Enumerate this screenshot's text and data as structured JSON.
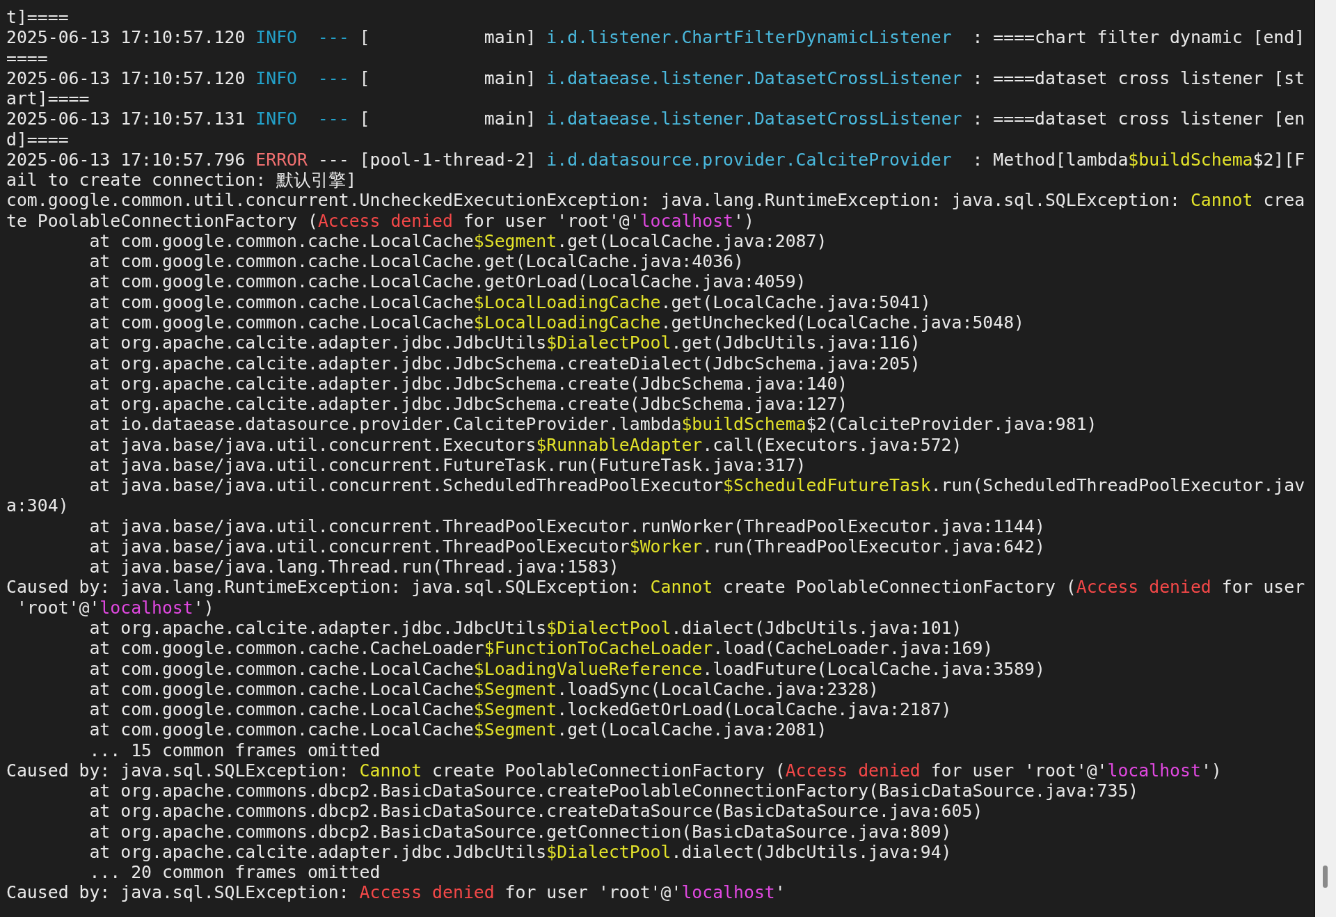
{
  "terminal": {
    "lines": [
      {
        "kind": "plain",
        "segments": [
          "t]===="
        ]
      },
      {
        "kind": "plain",
        "segments": [
          "2025-06-13 17:10:57.120 ",
          {
            "kind": "info",
            "text": "INFO  ---"
          },
          " [           main] ",
          {
            "kind": "logger",
            "text": "i.d.listener.ChartFilterDynamicListener"
          },
          "  : ====chart filter dynamic [end]"
        ]
      },
      {
        "kind": "plain",
        "segments": [
          "===="
        ]
      },
      {
        "kind": "plain",
        "segments": [
          "2025-06-13 17:10:57.120 ",
          {
            "kind": "info",
            "text": "INFO  ---"
          },
          " [           main] ",
          {
            "kind": "logger",
            "text": "i.dataease.listener.DatasetCrossListener"
          },
          " : ====dataset cross listener [st"
        ]
      },
      {
        "kind": "plain",
        "segments": [
          "art]===="
        ]
      },
      {
        "kind": "plain",
        "segments": [
          "2025-06-13 17:10:57.131 ",
          {
            "kind": "info",
            "text": "INFO  ---"
          },
          " [           main] ",
          {
            "kind": "logger",
            "text": "i.dataease.listener.DatasetCrossListener"
          },
          " : ====dataset cross listener [en"
        ]
      },
      {
        "kind": "plain",
        "segments": [
          "d]===="
        ]
      },
      {
        "kind": "plain",
        "segments": [
          "2025-06-13 17:10:57.796 ",
          {
            "kind": "error",
            "text": "ERROR"
          },
          " --- [pool-1-thread-2] ",
          {
            "kind": "logger",
            "text": "i.d.datasource.provider.CalciteProvider"
          },
          "  : Method[lambda",
          {
            "kind": "keyword",
            "text": "$buildSchema"
          },
          "$2][F"
        ]
      },
      {
        "kind": "plain",
        "segments": [
          "ail to create connection: 默认引擎]"
        ]
      },
      {
        "kind": "plain",
        "segments": [
          "com.google.common.util.concurrent.UncheckedExecutionException: java.lang.RuntimeException: java.sql.SQLException: ",
          {
            "kind": "keyword",
            "text": "Cannot"
          },
          " crea"
        ]
      },
      {
        "kind": "plain",
        "segments": [
          "te PoolableConnectionFactory (",
          {
            "kind": "denied",
            "text": "Access denied"
          },
          " for user 'root'@'",
          {
            "kind": "host",
            "text": "localhost"
          },
          "')"
        ]
      },
      {
        "kind": "frame",
        "segments": [
          "at com.google.common.cache.LocalCache",
          {
            "kind": "keyword",
            "text": "$Segment"
          },
          ".get(LocalCache.java:2087)"
        ]
      },
      {
        "kind": "frame",
        "segments": [
          "at com.google.common.cache.LocalCache.get(LocalCache.java:4036)"
        ]
      },
      {
        "kind": "frame",
        "segments": [
          "at com.google.common.cache.LocalCache.getOrLoad(LocalCache.java:4059)"
        ]
      },
      {
        "kind": "frame",
        "segments": [
          "at com.google.common.cache.LocalCache",
          {
            "kind": "keyword",
            "text": "$LocalLoadingCache"
          },
          ".get(LocalCache.java:5041)"
        ]
      },
      {
        "kind": "frame",
        "segments": [
          "at com.google.common.cache.LocalCache",
          {
            "kind": "keyword",
            "text": "$LocalLoadingCache"
          },
          ".getUnchecked(LocalCache.java:5048)"
        ]
      },
      {
        "kind": "frame",
        "segments": [
          "at org.apache.calcite.adapter.jdbc.JdbcUtils",
          {
            "kind": "keyword",
            "text": "$DialectPool"
          },
          ".get(JdbcUtils.java:116)"
        ]
      },
      {
        "kind": "frame",
        "segments": [
          "at org.apache.calcite.adapter.jdbc.JdbcSchema.createDialect(JdbcSchema.java:205)"
        ]
      },
      {
        "kind": "frame",
        "segments": [
          "at org.apache.calcite.adapter.jdbc.JdbcSchema.create(JdbcSchema.java:140)"
        ]
      },
      {
        "kind": "frame",
        "segments": [
          "at org.apache.calcite.adapter.jdbc.JdbcSchema.create(JdbcSchema.java:127)"
        ]
      },
      {
        "kind": "frame",
        "segments": [
          "at io.dataease.datasource.provider.CalciteProvider.lambda",
          {
            "kind": "keyword",
            "text": "$buildSchema"
          },
          "$2(CalciteProvider.java:981)"
        ]
      },
      {
        "kind": "frame",
        "segments": [
          "at java.base/java.util.concurrent.Executors",
          {
            "kind": "keyword",
            "text": "$RunnableAdapter"
          },
          ".call(Executors.java:572)"
        ]
      },
      {
        "kind": "frame",
        "segments": [
          "at java.base/java.util.concurrent.FutureTask.run(FutureTask.java:317)"
        ]
      },
      {
        "kind": "frame",
        "segments": [
          "at java.base/java.util.concurrent.ScheduledThreadPoolExecutor",
          {
            "kind": "keyword",
            "text": "$ScheduledFutureTask"
          },
          ".run(ScheduledThreadPoolExecutor.jav"
        ]
      },
      {
        "kind": "plain",
        "segments": [
          "a:304)"
        ]
      },
      {
        "kind": "frame",
        "segments": [
          "at java.base/java.util.concurrent.ThreadPoolExecutor.runWorker(ThreadPoolExecutor.java:1144)"
        ]
      },
      {
        "kind": "frame",
        "segments": [
          "at java.base/java.util.concurrent.ThreadPoolExecutor",
          {
            "kind": "keyword",
            "text": "$Worker"
          },
          ".run(ThreadPoolExecutor.java:642)"
        ]
      },
      {
        "kind": "frame",
        "segments": [
          "at java.base/java.lang.Thread.run(Thread.java:1583)"
        ]
      },
      {
        "kind": "plain",
        "segments": [
          "Caused by: java.lang.RuntimeException: java.sql.SQLException: ",
          {
            "kind": "keyword",
            "text": "Cannot"
          },
          " create PoolableConnectionFactory (",
          {
            "kind": "denied",
            "text": "Access denied"
          },
          " for user"
        ]
      },
      {
        "kind": "continued",
        "segments": [
          "'root'@'",
          {
            "kind": "host",
            "text": "localhost"
          },
          "')"
        ]
      },
      {
        "kind": "frame",
        "segments": [
          "at org.apache.calcite.adapter.jdbc.JdbcUtils",
          {
            "kind": "keyword",
            "text": "$DialectPool"
          },
          ".dialect(JdbcUtils.java:101)"
        ]
      },
      {
        "kind": "frame",
        "segments": [
          "at com.google.common.cache.CacheLoader",
          {
            "kind": "keyword",
            "text": "$FunctionToCacheLoader"
          },
          ".load(CacheLoader.java:169)"
        ]
      },
      {
        "kind": "frame",
        "segments": [
          "at com.google.common.cache.LocalCache",
          {
            "kind": "keyword",
            "text": "$LoadingValueReference"
          },
          ".loadFuture(LocalCache.java:3589)"
        ]
      },
      {
        "kind": "frame",
        "segments": [
          "at com.google.common.cache.LocalCache",
          {
            "kind": "keyword",
            "text": "$Segment"
          },
          ".loadSync(LocalCache.java:2328)"
        ]
      },
      {
        "kind": "frame",
        "segments": [
          "at com.google.common.cache.LocalCache",
          {
            "kind": "keyword",
            "text": "$Segment"
          },
          ".lockedGetOrLoad(LocalCache.java:2187)"
        ]
      },
      {
        "kind": "frame",
        "segments": [
          "at com.google.common.cache.LocalCache",
          {
            "kind": "keyword",
            "text": "$Segment"
          },
          ".get(LocalCache.java:2081)"
        ]
      },
      {
        "kind": "frame",
        "segments": [
          "... 15 common frames omitted"
        ]
      },
      {
        "kind": "plain",
        "segments": [
          "Caused by: java.sql.SQLException: ",
          {
            "kind": "keyword",
            "text": "Cannot"
          },
          " create PoolableConnectionFactory (",
          {
            "kind": "denied",
            "text": "Access denied"
          },
          " for user 'root'@'",
          {
            "kind": "host",
            "text": "localhost"
          },
          "')"
        ]
      },
      {
        "kind": "frame",
        "segments": [
          "at org.apache.commons.dbcp2.BasicDataSource.createPoolableConnectionFactory(BasicDataSource.java:735)"
        ]
      },
      {
        "kind": "frame",
        "segments": [
          "at org.apache.commons.dbcp2.BasicDataSource.createDataSource(BasicDataSource.java:605)"
        ]
      },
      {
        "kind": "frame",
        "segments": [
          "at org.apache.commons.dbcp2.BasicDataSource.getConnection(BasicDataSource.java:809)"
        ]
      },
      {
        "kind": "frame",
        "segments": [
          "at org.apache.calcite.adapter.jdbc.JdbcUtils",
          {
            "kind": "keyword",
            "text": "$DialectPool"
          },
          ".dialect(JdbcUtils.java:94)"
        ]
      },
      {
        "kind": "frame",
        "segments": [
          "... 20 common frames omitted"
        ]
      },
      {
        "kind": "plain",
        "segments": [
          "Caused by: java.sql.SQLException: ",
          {
            "kind": "denied",
            "text": "Access denied"
          },
          " for user 'root'@'",
          {
            "kind": "host",
            "text": "localhost"
          },
          "'"
        ]
      }
    ]
  }
}
